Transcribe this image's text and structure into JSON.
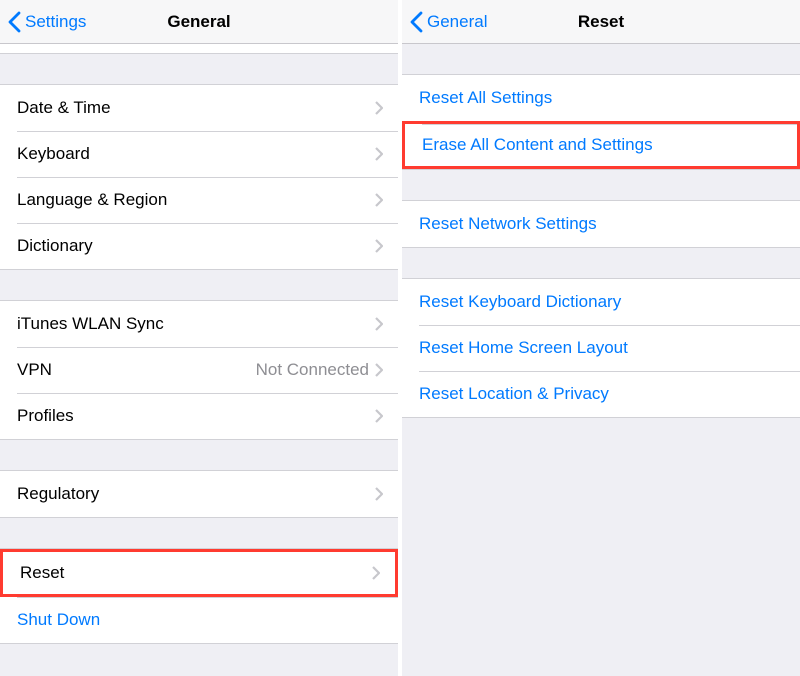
{
  "left": {
    "nav": {
      "back_label": "Settings",
      "title": "General"
    },
    "groups": [
      {
        "rows": [
          {
            "label": "Date & Time",
            "has_chevron": true
          },
          {
            "label": "Keyboard",
            "has_chevron": true
          },
          {
            "label": "Language & Region",
            "has_chevron": true
          },
          {
            "label": "Dictionary",
            "has_chevron": true
          }
        ]
      },
      {
        "rows": [
          {
            "label": "iTunes WLAN Sync",
            "has_chevron": true
          },
          {
            "label": "VPN",
            "detail": "Not Connected",
            "has_chevron": true
          },
          {
            "label": "Profiles",
            "has_chevron": true
          }
        ]
      },
      {
        "rows": [
          {
            "label": "Regulatory",
            "has_chevron": true
          }
        ]
      },
      {
        "rows": [
          {
            "label": "Reset",
            "has_chevron": true,
            "highlight": true
          },
          {
            "label": "Shut Down",
            "blue": true,
            "has_chevron": false
          }
        ]
      }
    ]
  },
  "right": {
    "nav": {
      "back_label": "General",
      "title": "Reset"
    },
    "groups": [
      {
        "rows": [
          {
            "label": "Reset All Settings"
          },
          {
            "label": "Erase All Content and Settings",
            "highlight": true
          }
        ]
      },
      {
        "rows": [
          {
            "label": "Reset Network Settings"
          }
        ]
      },
      {
        "rows": [
          {
            "label": "Reset Keyboard Dictionary"
          },
          {
            "label": "Reset Home Screen Layout"
          },
          {
            "label": "Reset Location & Privacy"
          }
        ]
      }
    ]
  }
}
